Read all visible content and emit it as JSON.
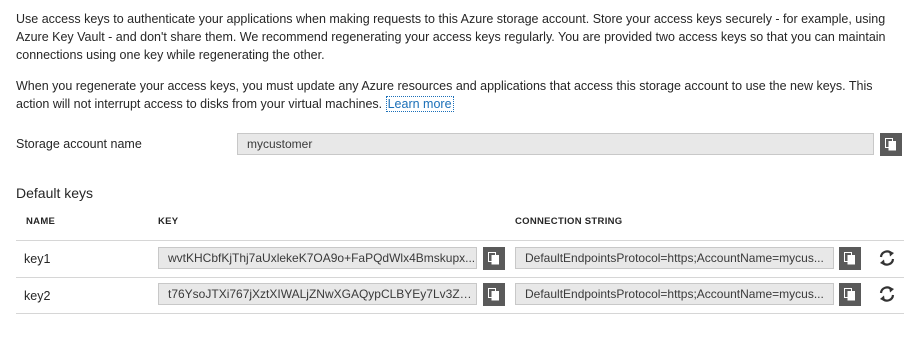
{
  "intro": {
    "paragraph1": "Use access keys to authenticate your applications when making requests to this Azure storage account. Store your access keys securely - for example, using Azure Key Vault - and don't share them. We recommend regenerating your access keys regularly. You are provided two access keys so that you can maintain connections using one key while regenerating the other.",
    "paragraph2": "When you regenerate your access keys, you must update any Azure resources and applications that access this storage account to use the new keys. This action will not interrupt access to disks from your virtual machines.",
    "learn_more": "Learn more"
  },
  "storage_account": {
    "label": "Storage account name",
    "value": "mycustomer"
  },
  "default_keys": {
    "title": "Default keys",
    "columns": {
      "name": "NAME",
      "key": "KEY",
      "connection_string": "CONNECTION STRING"
    },
    "rows": [
      {
        "name": "key1",
        "key": "wvtKHCbfKjThj7aUxlekeK7OA9o+FaPQdWlx4Bmskupx...",
        "connection_string": "DefaultEndpointsProtocol=https;AccountName=mycus..."
      },
      {
        "name": "key2",
        "key": "t76YsoJTXi767jXztXIWALjZNwXGAQypCLBYEy7Lv3Z1C...",
        "connection_string": "DefaultEndpointsProtocol=https;AccountName=mycus..."
      }
    ]
  },
  "icons": {
    "copy": "copy-icon",
    "regenerate": "refresh-icon"
  },
  "colors": {
    "link": "#1a6fb8",
    "button_bg": "#5a5a5a",
    "field_bg": "#e8e8e8"
  }
}
